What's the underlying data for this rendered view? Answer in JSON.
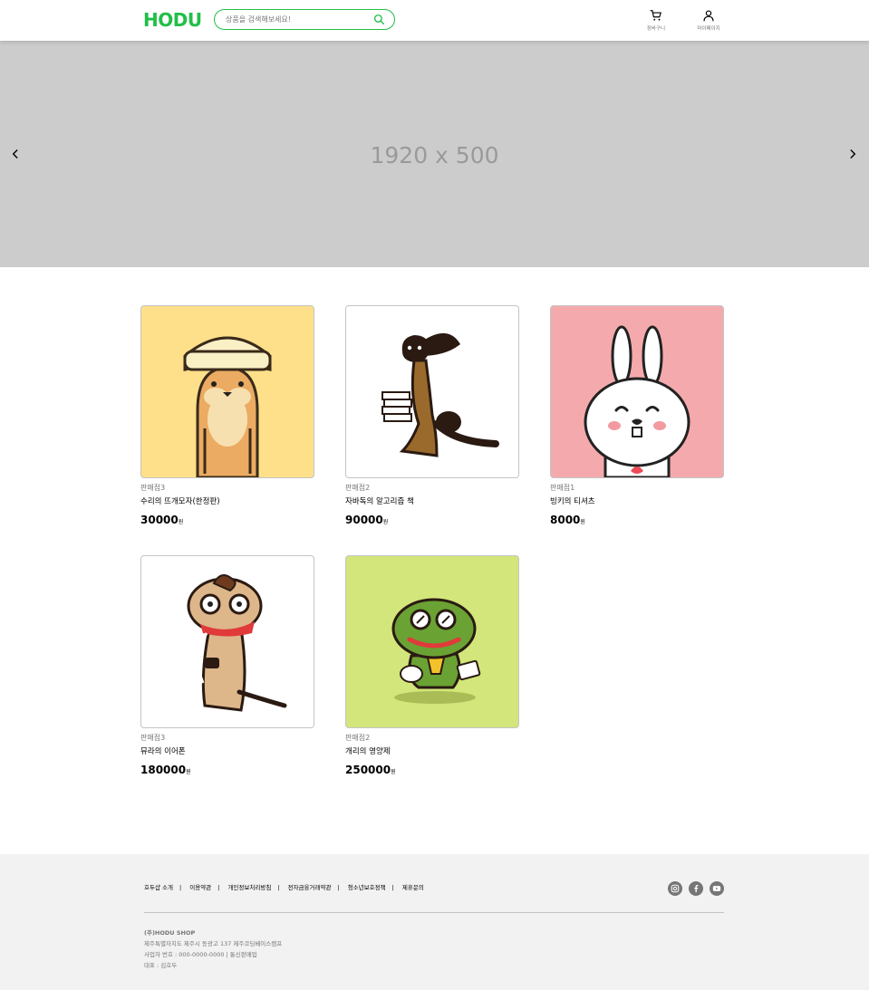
{
  "header": {
    "logo": "HODU",
    "search_placeholder": "상품을 검색해보세요!",
    "cart_label": "장바구니",
    "mypage_label": "마이페이지"
  },
  "banner": {
    "text": "1920 x 500"
  },
  "products": [
    {
      "seller": "판매점3",
      "name": "수리의 뜨개모자(한정판)",
      "price": "30000",
      "unit": "원",
      "bg": "#ffe08a"
    },
    {
      "seller": "판매점2",
      "name": "자바독의 알고리즘 책",
      "price": "90000",
      "unit": "원",
      "bg": "#ffffff"
    },
    {
      "seller": "판매점1",
      "name": "빙키의 티셔츠",
      "price": "8000",
      "unit": "원",
      "bg": "#f4aaac"
    },
    {
      "seller": "판매점3",
      "name": "뮤라의 이어폰",
      "price": "180000",
      "unit": "원",
      "bg": "#ffffff"
    },
    {
      "seller": "판매점2",
      "name": "개리의 영양제",
      "price": "250000",
      "unit": "원",
      "bg": "#d2e67b"
    }
  ],
  "footer": {
    "links": [
      "호두샵 소개",
      "이용약관",
      "개인정보처리방침",
      "전자금융거래약관",
      "청소년보호정책",
      "제휴문의"
    ],
    "company": "(주)HODU SHOP",
    "address": "제주특별자치도 제주시 동광고 137 제주코딩베이스캠프",
    "business": "사업자 번호 : 000-0000-0000 | 통신판매업",
    "ceo": "대표 : 김호두",
    "sns": [
      "instagram-icon",
      "facebook-icon",
      "youtube-icon"
    ]
  },
  "colors": {
    "brand": "#21bf48",
    "banner_bg": "#cccccc",
    "footer_bg": "#f2f2f2"
  }
}
